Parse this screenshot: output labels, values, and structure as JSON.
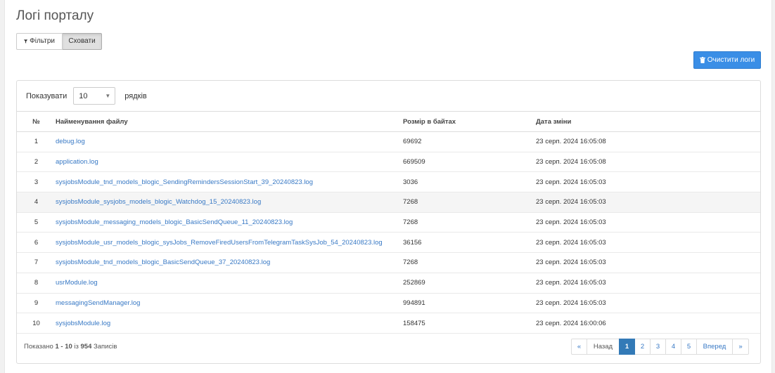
{
  "page": {
    "title": "Логі порталу"
  },
  "toolbar": {
    "filters_label": "Фільтри",
    "hide_label": "Сховати",
    "clear_label": "Очистити логи"
  },
  "length": {
    "prefix": "Показувати",
    "value": "10",
    "suffix": "рядків"
  },
  "table": {
    "headers": {
      "num": "№",
      "name": "Найменування файлу",
      "size": "Розмір в байтах",
      "date": "Дата зміни"
    },
    "rows": [
      {
        "num": "1",
        "name": "debug.log",
        "size": "69692",
        "date": "23 серп. 2024 16:05:08"
      },
      {
        "num": "2",
        "name": "application.log",
        "size": "669509",
        "date": "23 серп. 2024 16:05:08"
      },
      {
        "num": "3",
        "name": "sysjobsModule_tnd_models_blogic_SendingRemindersSessionStart_39_20240823.log",
        "size": "3036",
        "date": "23 серп. 2024 16:05:03"
      },
      {
        "num": "4",
        "name": "sysjobsModule_sysjobs_models_blogic_Watchdog_15_20240823.log",
        "size": "7268",
        "date": "23 серп. 2024 16:05:03"
      },
      {
        "num": "5",
        "name": "sysjobsModule_messaging_models_blogic_BasicSendQueue_11_20240823.log",
        "size": "7268",
        "date": "23 серп. 2024 16:05:03"
      },
      {
        "num": "6",
        "name": "sysjobsModule_usr_models_blogic_sysJobs_RemoveFiredUsersFromTelegramTaskSysJob_54_20240823.log",
        "size": "36156",
        "date": "23 серп. 2024 16:05:03"
      },
      {
        "num": "7",
        "name": "sysjobsModule_tnd_models_blogic_BasicSendQueue_37_20240823.log",
        "size": "7268",
        "date": "23 серп. 2024 16:05:03"
      },
      {
        "num": "8",
        "name": "usrModule.log",
        "size": "252869",
        "date": "23 серп. 2024 16:05:03"
      },
      {
        "num": "9",
        "name": "messagingSendManager.log",
        "size": "994891",
        "date": "23 серп. 2024 16:05:03"
      },
      {
        "num": "10",
        "name": "sysjobsModule.log",
        "size": "158475",
        "date": "23 серп. 2024 16:00:06"
      }
    ]
  },
  "info": {
    "prefix": "Показано",
    "range": "1 - 10",
    "of": "із",
    "total": "954",
    "suffix": "Записів"
  },
  "pagination": {
    "first": "«",
    "prev": "Назад",
    "pages": [
      "1",
      "2",
      "3",
      "4",
      "5"
    ],
    "next": "Вперед",
    "last": "»",
    "active": "1"
  },
  "icons": {
    "filter": "filter-icon",
    "trash": "trash-icon"
  },
  "colors": {
    "accent": "#3a8ee6",
    "link": "#3879c5",
    "active_page": "#337ab7"
  }
}
